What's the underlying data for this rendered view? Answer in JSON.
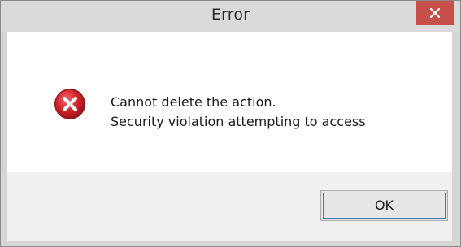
{
  "window": {
    "title": "Error",
    "close_icon": "close-icon"
  },
  "message": {
    "icon": "error-icon",
    "line1": "Cannot delete the action.",
    "line2": "Security violation attempting to access"
  },
  "buttons": {
    "ok_label": "OK"
  },
  "colors": {
    "close_button": "#c7504a",
    "error_icon": "#c8202a",
    "titlebar": "#d9d9d9"
  }
}
